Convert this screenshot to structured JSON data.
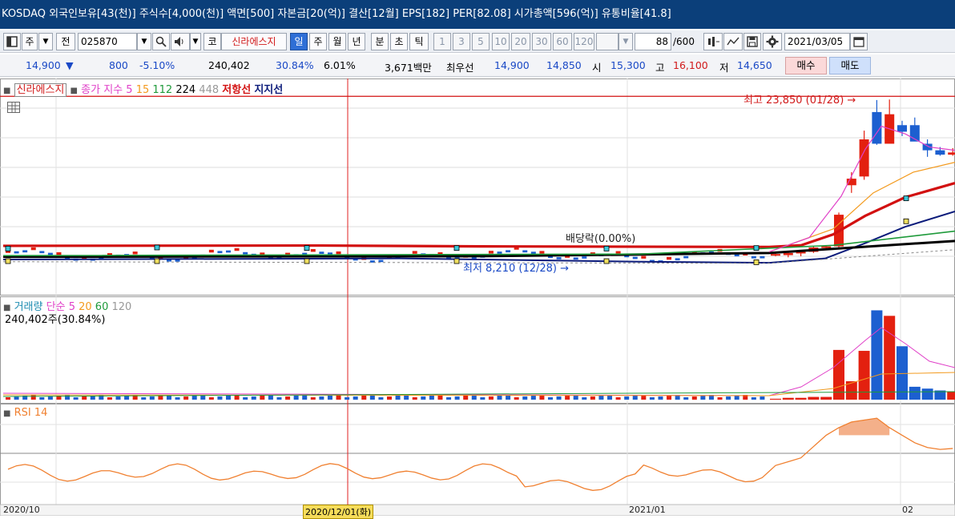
{
  "info_bar": {
    "text": "KOSDAQ 외국인보유[43(천)] 주식수[4,000(천)] 액면[500] 자본금[20(억)] 결산[12월] EPS[182] PER[82.08] 시가총액[596(억)] 유통비율[41.8]"
  },
  "toolbar": {
    "type_label": "주",
    "all_label": "전",
    "stock_code": "025870",
    "market_label": "코",
    "stock_name": "신라에스지",
    "periods": [
      "일",
      "주",
      "월",
      "년",
      "분",
      "초",
      "틱"
    ],
    "active_period": "일",
    "intervals": [
      "1",
      "3",
      "5",
      "10",
      "20",
      "30",
      "60",
      "120"
    ],
    "count_value": "88",
    "count_total": "/600",
    "date": "2021/03/05"
  },
  "price_line": {
    "price": "14,900",
    "arrow": "▼",
    "change": "800",
    "change_pct": "-5.10%",
    "volume": "240,402",
    "volume_pct": "30.84%",
    "turnover_pct": "6.01%",
    "amount": "3,671백만",
    "bid_label": "최우선",
    "ask_price": "14,900",
    "bid_price": "14,850",
    "open_label": "시",
    "open": "15,300",
    "high_label": "고",
    "high": "16,100",
    "low_label": "저",
    "low": "14,650",
    "buy_label": "매수",
    "sell_label": "매도"
  },
  "price_panel": {
    "stock_name": "신라에스지",
    "legend_prefix": "종가 지수",
    "ma_periods": [
      "5",
      "15",
      "112",
      "224",
      "448"
    ],
    "resistance_label": "저항선",
    "support_label": "지지선",
    "high_annotation": "최고 23,850 (01/28) →",
    "dividend_annotation": "배당락(0.00%)",
    "low_annotation": "최저 8,210 (12/28) →"
  },
  "volume_panel": {
    "legend_label": "거래량",
    "legend_simple": "단순",
    "ma_periods": [
      "5",
      "20",
      "60",
      "120"
    ],
    "volume_readout": "240,402주(30.84%)"
  },
  "rsi_panel": {
    "legend_label": "RSI 14"
  },
  "x_axis": {
    "labels": [
      "2020/10",
      "2020/12/01(화)",
      "2021/01",
      "02"
    ]
  },
  "colors": {
    "up": "#e3200f",
    "down": "#1c5fd0",
    "ma5": "#e040c8",
    "ma15": "#f39a1e",
    "ma112": "#1e9a3a",
    "ma224": "#000000",
    "resistance": "#d21010",
    "support": "#0a1a7a",
    "rsi": "#f08030",
    "crosshair": "#e02020"
  },
  "chart_data": {
    "type": "candlestick",
    "price": {
      "candles_recent": [
        {
          "open": 9700,
          "high": 9800,
          "low": 9500,
          "close": 9700
        },
        {
          "open": 9600,
          "high": 9900,
          "low": 9400,
          "close": 9800
        },
        {
          "open": 9800,
          "high": 10000,
          "low": 9500,
          "close": 9900
        },
        {
          "open": 9900,
          "high": 10400,
          "low": 9800,
          "close": 10300
        },
        {
          "open": 10300,
          "high": 10500,
          "low": 10100,
          "close": 10400
        },
        {
          "open": 10400,
          "high": 13500,
          "low": 10300,
          "close": 13300
        },
        {
          "open": 16000,
          "high": 17200,
          "low": 15300,
          "close": 16600
        },
        {
          "open": 16800,
          "high": 21000,
          "low": 16500,
          "close": 20200
        },
        {
          "open": 22700,
          "high": 23800,
          "low": 19700,
          "close": 19800
        },
        {
          "open": 19800,
          "high": 23850,
          "low": 20700,
          "close": 22500
        },
        {
          "open": 21500,
          "high": 21900,
          "low": 20500,
          "close": 20900
        },
        {
          "open": 21500,
          "high": 22200,
          "low": 20100,
          "close": 20000
        },
        {
          "open": 19800,
          "high": 20200,
          "low": 18600,
          "close": 19200
        },
        {
          "open": 19200,
          "high": 19500,
          "low": 18700,
          "close": 18800
        },
        {
          "open": 18800,
          "high": 19400,
          "low": 18700,
          "close": 19000
        }
      ],
      "all_time_high": 23850,
      "period_low": 8210
    },
    "volume_recent": [
      1,
      2,
      2,
      3,
      3,
      54,
      20,
      53,
      97,
      91,
      58,
      14,
      12,
      10,
      9
    ],
    "rsi_recent": [
      38,
      42,
      46,
      58,
      70,
      78,
      84,
      86,
      88,
      78,
      70,
      62,
      57,
      55,
      56
    ]
  }
}
